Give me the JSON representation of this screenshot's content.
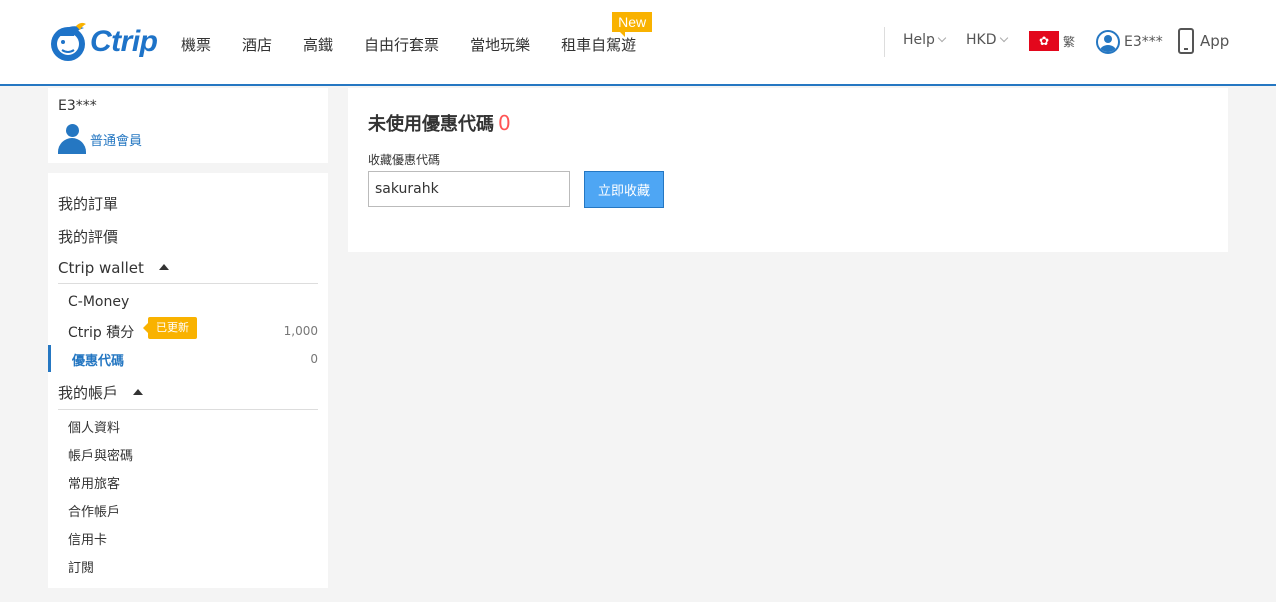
{
  "header": {
    "logo_text": "Ctrip",
    "nav": [
      "機票",
      "酒店",
      "高鐵",
      "自由行套票",
      "當地玩樂",
      "租車自駕遊"
    ],
    "new_badge": "New",
    "help": "Help",
    "currency": "HKD",
    "language": "繁",
    "user": "E3***",
    "app": "App"
  },
  "sidebar": {
    "username": "E3***",
    "member_level": "普通會員",
    "menu": {
      "orders": "我的訂單",
      "reviews": "我的評價",
      "wallet_title": "Ctrip wallet",
      "wallet_items": [
        {
          "label": "C-Money",
          "value": ""
        },
        {
          "label": "Ctrip 積分",
          "value": "1,000",
          "badge": "已更新"
        },
        {
          "label": "優惠代碼",
          "value": "0"
        }
      ],
      "account_title": "我的帳戶",
      "account_items": [
        "個人資料",
        "帳戶與密碼",
        "常用旅客",
        "合作帳戶",
        "信用卡",
        "訂閱"
      ]
    }
  },
  "main": {
    "title": "未使用優惠代碼",
    "count": "0",
    "field_label": "收藏優惠代碼",
    "input_value": "sakurahk",
    "button_label": "立即收藏"
  },
  "colors": {
    "brand_blue": "#2577c2",
    "badge_yellow": "#f9b200",
    "button_blue": "#4ea6f4",
    "count_red": "#f55555"
  }
}
